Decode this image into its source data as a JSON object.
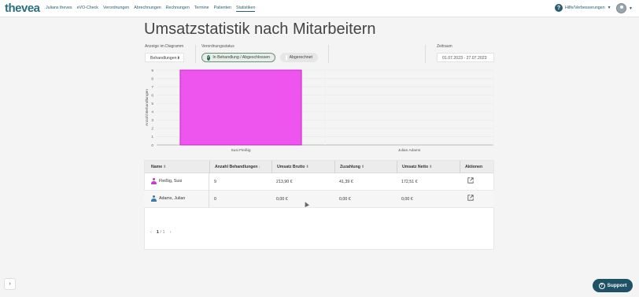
{
  "app": {
    "logo_prefix": "the",
    "logo_suffix": "vea"
  },
  "nav": {
    "items": [
      {
        "label": "Julians theves"
      },
      {
        "label": "eVO-Check"
      },
      {
        "label": "Verordnungen"
      },
      {
        "label": "Abrechnungen"
      },
      {
        "label": "Rechnungen"
      },
      {
        "label": "Termine"
      },
      {
        "label": "Patienten"
      },
      {
        "label": "Statistiken",
        "active": true
      }
    ],
    "help_label": "Hilfe/Verbesserungen",
    "help_icon": "?"
  },
  "page": {
    "title": "Umsatzstatistik nach Mitarbeitern"
  },
  "filters": {
    "diagram_label": "Anzeige im Diagramm",
    "diagram_value": "Behandlungen",
    "status_label": "Verordnungsstatus",
    "status_on": "In Behandlung / Abgeschlossen",
    "status_off": "Abgerechnet",
    "range_label": "Zeitraum",
    "range_value": "01.07.2023 - 27.07.2023"
  },
  "chart_data": {
    "type": "bar",
    "categories": [
      "Susi Fleißig",
      "Julian Adams"
    ],
    "values": [
      9,
      0
    ],
    "ylabel": "Anzahl Behandlungen",
    "ylim": [
      0,
      9
    ],
    "yticks": [
      0,
      1,
      2,
      3,
      4,
      5,
      6,
      7,
      8,
      9
    ],
    "grid": true,
    "bar_color": "#ee55ee",
    "bar_border": "#cc22cc"
  },
  "table": {
    "headers": {
      "name": "Name",
      "count": "Anzahl Behandlungen",
      "gross": "Umsatz Brutto",
      "copay": "Zuzahlung",
      "net": "Umsatz Netto",
      "actions": "Aktionen"
    },
    "rows": [
      {
        "name": "Fleißig, Susi",
        "count": "9",
        "gross": "213,90 €",
        "copay": "41,39 €",
        "net": "172,51 €",
        "icon_color": "#c040c0"
      },
      {
        "name": "Adams, Julian",
        "count": "0",
        "gross": "0,00 €",
        "copay": "0,00 €",
        "net": "0,00 €",
        "icon_color": "#3b79a8"
      }
    ]
  },
  "pager": {
    "current": "1",
    "separator": "/",
    "total": "1"
  },
  "support": {
    "label": "Support"
  },
  "colors": {
    "brand": "#2a6f7f",
    "support_bg": "#1f5267"
  }
}
